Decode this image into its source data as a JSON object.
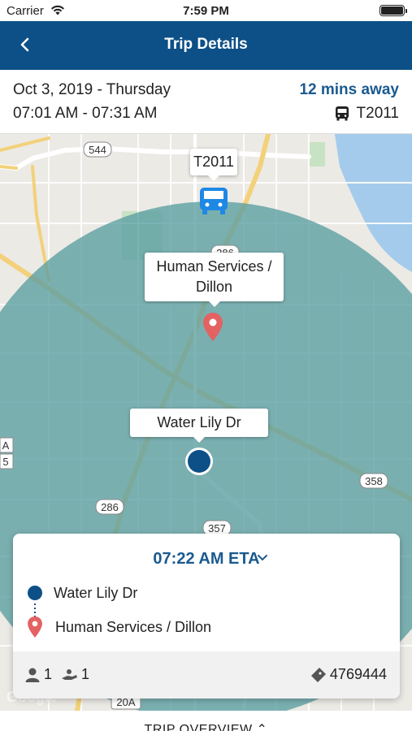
{
  "status_bar": {
    "carrier": "Carrier",
    "time": "7:59 PM"
  },
  "nav": {
    "title": "Trip Details"
  },
  "trip": {
    "date": "Oct 3, 2019 - Thursday",
    "time_window": "07:01 AM - 07:31 AM",
    "eta_away": "12 mins away",
    "vehicle": "T2011"
  },
  "map": {
    "vehicle_label": "T2011",
    "dropoff_label": "Human Services / Dillon",
    "pickup_label": "Water Lily Dr",
    "road_shields": [
      "544",
      "286",
      "286",
      "358",
      "357",
      "20A",
      "A",
      "5"
    ],
    "attribution": "Google",
    "colors": {
      "radius": "#5a9da1",
      "vehicle": "#1e88e5",
      "pin": "#e36262",
      "pickup": "#0d5087",
      "water": "#a4cbeb"
    }
  },
  "eta_card": {
    "eta": "07:22 AM ETA",
    "pickup": "Water Lily Dr",
    "dropoff": "Human Services / Dillon",
    "passengers": "1",
    "companions": "1",
    "confirmation": "4769444"
  },
  "overview": {
    "label": "TRIP OVERVIEW"
  }
}
